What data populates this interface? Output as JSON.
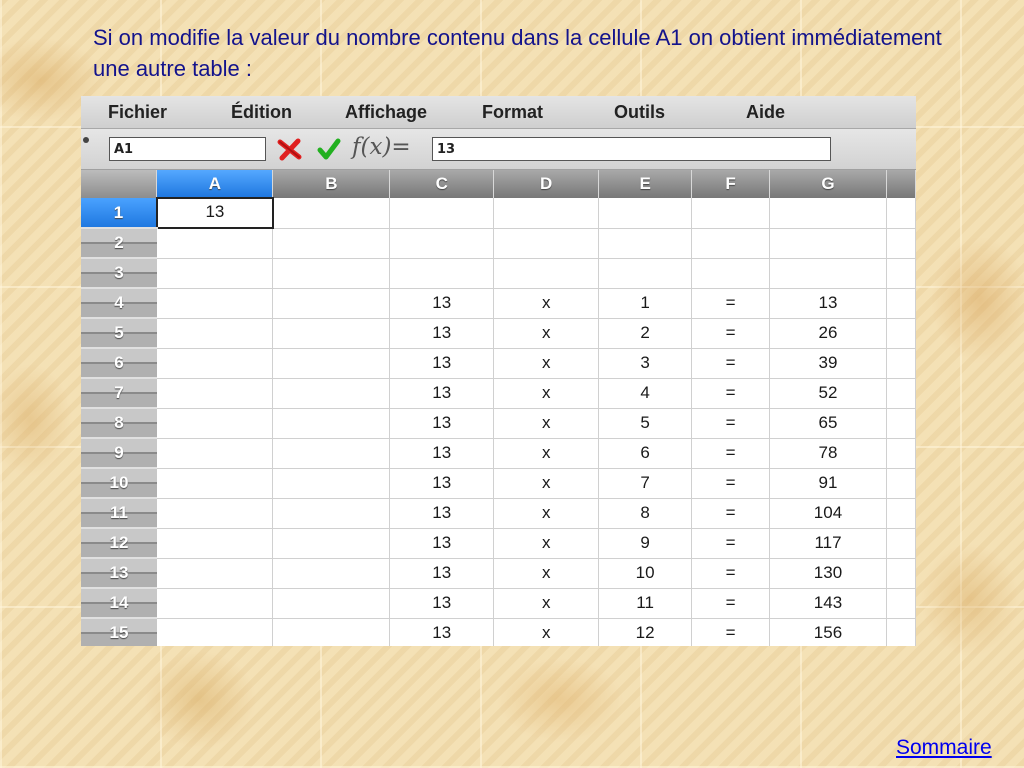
{
  "intro_text": "Si on modifie la valeur du nombre contenu dans la cellule A1 on obtient immédiatement une autre table :",
  "menu": [
    "Fichier",
    "Édition",
    "Affichage",
    "Format",
    "Outils",
    "Aide"
  ],
  "formula_bar": {
    "cell_ref": "A1",
    "fx_label": "f(x)=",
    "value": "13",
    "cancel_icon": "cancel-icon",
    "accept_icon": "accept-icon"
  },
  "columns": [
    "A",
    "B",
    "C",
    "D",
    "E",
    "F",
    "G"
  ],
  "active_column": "A",
  "active_row": "1",
  "rows": [
    {
      "num": "1",
      "cells": [
        "13",
        "",
        "",
        "",
        "",
        "",
        ""
      ]
    },
    {
      "num": "2",
      "cells": [
        "",
        "",
        "",
        "",
        "",
        "",
        ""
      ]
    },
    {
      "num": "3",
      "cells": [
        "",
        "",
        "",
        "",
        "",
        "",
        ""
      ]
    },
    {
      "num": "4",
      "cells": [
        "",
        "",
        "13",
        "x",
        "1",
        "=",
        "13"
      ]
    },
    {
      "num": "5",
      "cells": [
        "",
        "",
        "13",
        "x",
        "2",
        "=",
        "26"
      ]
    },
    {
      "num": "6",
      "cells": [
        "",
        "",
        "13",
        "x",
        "3",
        "=",
        "39"
      ]
    },
    {
      "num": "7",
      "cells": [
        "",
        "",
        "13",
        "x",
        "4",
        "=",
        "52"
      ]
    },
    {
      "num": "8",
      "cells": [
        "",
        "",
        "13",
        "x",
        "5",
        "=",
        "65"
      ]
    },
    {
      "num": "9",
      "cells": [
        "",
        "",
        "13",
        "x",
        "6",
        "=",
        "78"
      ]
    },
    {
      "num": "10",
      "cells": [
        "",
        "",
        "13",
        "x",
        "7",
        "=",
        "91"
      ]
    },
    {
      "num": "11",
      "cells": [
        "",
        "",
        "13",
        "x",
        "8",
        "=",
        "104"
      ]
    },
    {
      "num": "12",
      "cells": [
        "",
        "",
        "13",
        "x",
        "9",
        "=",
        "117"
      ]
    },
    {
      "num": "13",
      "cells": [
        "",
        "",
        "13",
        "x",
        "10",
        "=",
        "130"
      ]
    },
    {
      "num": "14",
      "cells": [
        "",
        "",
        "13",
        "x",
        "11",
        "=",
        "143"
      ]
    },
    {
      "num": "15",
      "cells": [
        "",
        "",
        "13",
        "x",
        "12",
        "=",
        "156"
      ]
    }
  ],
  "footer_link": "Sommaire",
  "colors": {
    "intro_text": "#13138c",
    "active_header": "#1f78e0",
    "cancel": "#e02020",
    "accept": "#22b020",
    "link": "#0000ee"
  }
}
